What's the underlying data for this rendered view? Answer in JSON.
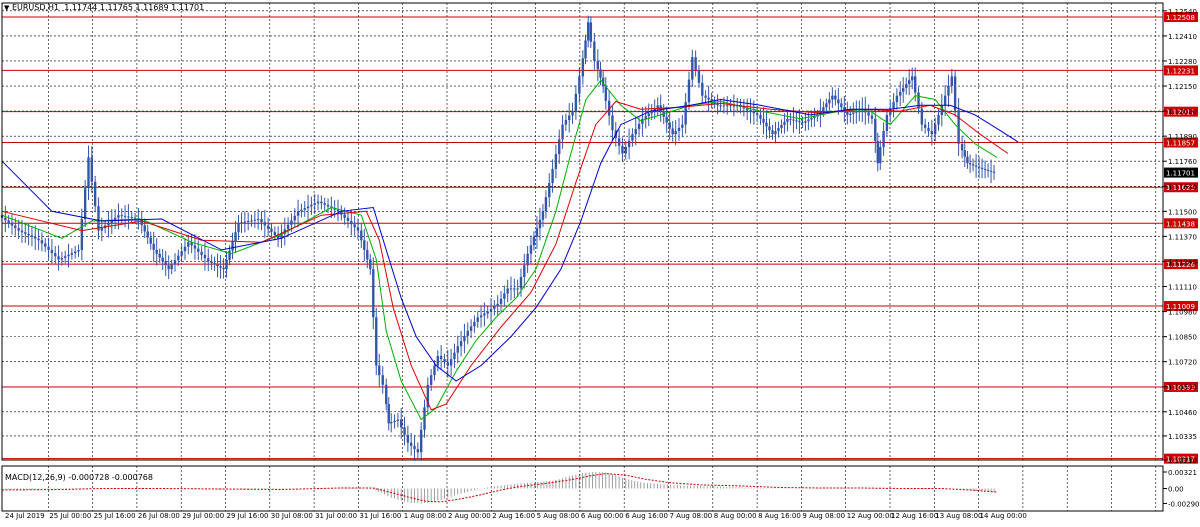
{
  "window": {
    "symbol_label": "EURUSD,H1",
    "ohlc_label": "1.11744 1.11765 1.11689 1.11701"
  },
  "chart_data": [
    {
      "type": "candlestick",
      "symbol": "EURUSD",
      "timeframe": "H1",
      "title": "EURUSD,H1  1.11744 1.11765 1.11689 1.11701",
      "ylim": [
        1.1021,
        1.1256
      ],
      "y_tick_labels": [
        "1.12540",
        "1.12410",
        "1.12280",
        "1.12150",
        "1.12020",
        "1.11890",
        "1.11760",
        "1.11630",
        "1.11500",
        "1.11370",
        "1.11240",
        "1.11110",
        "1.10980",
        "1.10850",
        "1.10720",
        "1.10590",
        "1.10460",
        "1.10335",
        "1.10210"
      ],
      "y_ticks": [
        1.1254,
        1.1241,
        1.1228,
        1.1215,
        1.1202,
        1.1189,
        1.1176,
        1.1163,
        1.115,
        1.1137,
        1.1124,
        1.1111,
        1.1098,
        1.1085,
        1.1072,
        1.1059,
        1.1046,
        1.10335,
        1.1021
      ],
      "x_tick_labels": [
        "24 Jul 2019",
        "25 Jul 00:00",
        "25 Jul 16:00",
        "26 Jul 08:00",
        "29 Jul 00:00",
        "29 Jul 16:00",
        "30 Jul 08:00",
        "31 Jul 00:00",
        "31 Jul 16:00",
        "1 Aug 08:00",
        "2 Aug 00:00",
        "2 Aug 16:00",
        "5 Aug 08:00",
        "6 Aug 00:00",
        "6 Aug 16:00",
        "7 Aug 08:00",
        "8 Aug 00:00",
        "8 Aug 16:00",
        "9 Aug 08:00",
        "12 Aug 00:00",
        "12 Aug 16:00",
        "13 Aug 08:00",
        "14 Aug 00:00"
      ],
      "last_price": "1.11701",
      "price_series": [
        [
          0,
          1.1148
        ],
        [
          20,
          1.114
        ],
        [
          40,
          1.1135
        ],
        [
          60,
          1.1125
        ],
        [
          80,
          1.113
        ],
        [
          90,
          1.1178
        ],
        [
          100,
          1.114
        ],
        [
          120,
          1.1148
        ],
        [
          140,
          1.1146
        ],
        [
          155,
          1.113
        ],
        [
          170,
          1.112
        ],
        [
          190,
          1.1134
        ],
        [
          210,
          1.1124
        ],
        [
          225,
          1.112
        ],
        [
          240,
          1.1144
        ],
        [
          260,
          1.1146
        ],
        [
          280,
          1.1136
        ],
        [
          300,
          1.115
        ],
        [
          320,
          1.1155
        ],
        [
          340,
          1.115
        ],
        [
          360,
          1.114
        ],
        [
          372,
          1.112
        ],
        [
          378,
          1.107
        ],
        [
          385,
          1.106
        ],
        [
          390,
          1.104
        ],
        [
          400,
          1.1042
        ],
        [
          410,
          1.103
        ],
        [
          420,
          1.1025
        ],
        [
          430,
          1.106
        ],
        [
          440,
          1.1075
        ],
        [
          450,
          1.107
        ],
        [
          460,
          1.108
        ],
        [
          470,
          1.1088
        ],
        [
          480,
          1.1095
        ],
        [
          490,
          1.1098
        ],
        [
          500,
          1.1102
        ],
        [
          510,
          1.111
        ],
        [
          520,
          1.111
        ],
        [
          530,
          1.1128
        ],
        [
          545,
          1.115
        ],
        [
          555,
          1.1172
        ],
        [
          565,
          1.1195
        ],
        [
          575,
          1.1202
        ],
        [
          582,
          1.122
        ],
        [
          590,
          1.1248
        ],
        [
          597,
          1.1228
        ],
        [
          605,
          1.1215
        ],
        [
          615,
          1.1192
        ],
        [
          625,
          1.118
        ],
        [
          635,
          1.119
        ],
        [
          645,
          1.1198
        ],
        [
          660,
          1.1205
        ],
        [
          675,
          1.119
        ],
        [
          685,
          1.1195
        ],
        [
          695,
          1.123
        ],
        [
          705,
          1.121
        ],
        [
          720,
          1.1205
        ],
        [
          740,
          1.1205
        ],
        [
          760,
          1.12
        ],
        [
          775,
          1.119
        ],
        [
          790,
          1.1198
        ],
        [
          805,
          1.1196
        ],
        [
          820,
          1.12
        ],
        [
          835,
          1.121
        ],
        [
          850,
          1.12
        ],
        [
          865,
          1.1203
        ],
        [
          875,
          1.1198
        ],
        [
          880,
          1.1175
        ],
        [
          890,
          1.12
        ],
        [
          900,
          1.121
        ],
        [
          915,
          1.122
        ],
        [
          925,
          1.1195
        ],
        [
          935,
          1.119
        ],
        [
          945,
          1.1205
        ],
        [
          955,
          1.122
        ],
        [
          962,
          1.1185
        ],
        [
          970,
          1.1175
        ],
        [
          985,
          1.1172
        ],
        [
          997,
          1.117
        ]
      ],
      "moving_averages": [
        {
          "color": "#00b000",
          "points": [
            [
              0,
              1.1148
            ],
            [
              60,
              1.1136
            ],
            [
              90,
              1.1145
            ],
            [
              140,
              1.1146
            ],
            [
              190,
              1.1134
            ],
            [
              230,
              1.1128
            ],
            [
              280,
              1.1138
            ],
            [
              330,
              1.1152
            ],
            [
              360,
              1.1148
            ],
            [
              375,
              1.1125
            ],
            [
              385,
              1.1088
            ],
            [
              400,
              1.1062
            ],
            [
              420,
              1.1042
            ],
            [
              435,
              1.1048
            ],
            [
              455,
              1.1067
            ],
            [
              475,
              1.1083
            ],
            [
              495,
              1.1095
            ],
            [
              515,
              1.1105
            ],
            [
              535,
              1.112
            ],
            [
              555,
              1.115
            ],
            [
              570,
              1.118
            ],
            [
              585,
              1.1208
            ],
            [
              600,
              1.1218
            ],
            [
              620,
              1.1205
            ],
            [
              640,
              1.1197
            ],
            [
              660,
              1.12
            ],
            [
              690,
              1.1205
            ],
            [
              720,
              1.1207
            ],
            [
              760,
              1.1202
            ],
            [
              800,
              1.1198
            ],
            [
              840,
              1.1202
            ],
            [
              870,
              1.1202
            ],
            [
              890,
              1.1195
            ],
            [
              915,
              1.121
            ],
            [
              935,
              1.1208
            ],
            [
              955,
              1.1195
            ],
            [
              975,
              1.1185
            ],
            [
              997,
              1.1178
            ]
          ]
        },
        {
          "color": "#e00000",
          "points": [
            [
              0,
              1.115
            ],
            [
              80,
              1.114
            ],
            [
              140,
              1.1145
            ],
            [
              200,
              1.1135
            ],
            [
              260,
              1.1134
            ],
            [
              320,
              1.1148
            ],
            [
              365,
              1.115
            ],
            [
              378,
              1.1135
            ],
            [
              392,
              1.11
            ],
            [
              410,
              1.107
            ],
            [
              430,
              1.1047
            ],
            [
              445,
              1.105
            ],
            [
              470,
              1.107
            ],
            [
              500,
              1.109
            ],
            [
              530,
              1.1108
            ],
            [
              555,
              1.1133
            ],
            [
              575,
              1.1165
            ],
            [
              595,
              1.1195
            ],
            [
              615,
              1.1207
            ],
            [
              640,
              1.1203
            ],
            [
              680,
              1.1204
            ],
            [
              720,
              1.1206
            ],
            [
              770,
              1.1203
            ],
            [
              820,
              1.1201
            ],
            [
              860,
              1.1203
            ],
            [
              900,
              1.1202
            ],
            [
              930,
              1.1205
            ],
            [
              955,
              1.12
            ],
            [
              980,
              1.119
            ],
            [
              1008,
              1.118
            ]
          ]
        },
        {
          "color": "#0000cc",
          "points": [
            [
              0,
              1.1176
            ],
            [
              50,
              1.115
            ],
            [
              100,
              1.1145
            ],
            [
              160,
              1.1146
            ],
            [
              220,
              1.113
            ],
            [
              280,
              1.1136
            ],
            [
              340,
              1.115
            ],
            [
              372,
              1.1152
            ],
            [
              385,
              1.113
            ],
            [
              400,
              1.1105
            ],
            [
              415,
              1.1085
            ],
            [
              435,
              1.107
            ],
            [
              455,
              1.1062
            ],
            [
              480,
              1.107
            ],
            [
              510,
              1.1085
            ],
            [
              535,
              1.11
            ],
            [
              560,
              1.112
            ],
            [
              580,
              1.1145
            ],
            [
              600,
              1.1175
            ],
            [
              620,
              1.1195
            ],
            [
              650,
              1.1202
            ],
            [
              690,
              1.1205
            ],
            [
              720,
              1.1208
            ],
            [
              760,
              1.1205
            ],
            [
              810,
              1.12
            ],
            [
              850,
              1.1203
            ],
            [
              890,
              1.1203
            ],
            [
              920,
              1.1205
            ],
            [
              950,
              1.1205
            ],
            [
              975,
              1.12
            ],
            [
              1000,
              1.1192
            ],
            [
              1018,
              1.1186
            ]
          ]
        }
      ],
      "horizontal_levels": [
        {
          "value": 1.12508,
          "label": "1.12508"
        },
        {
          "value": 1.12231,
          "label": "1.12231"
        },
        {
          "value": 1.12017,
          "label": "1.12017"
        },
        {
          "value": 1.11857,
          "label": "1.11857"
        },
        {
          "value": 1.11625,
          "label": "1.11625"
        },
        {
          "value": 1.11438,
          "label": "1.11438"
        },
        {
          "value": 1.11226,
          "label": "1.11226"
        },
        {
          "value": 1.11009,
          "label": "1.11009"
        },
        {
          "value": 1.10589,
          "label": "1.10589"
        },
        {
          "value": 1.10217,
          "label": "1.10217"
        }
      ],
      "colors": {
        "candles": "#3355aa",
        "levels": "#cc0000",
        "grid": "#000000"
      }
    },
    {
      "type": "histogram",
      "title": "MACD(12,26,9) -0.000728 -0.000768",
      "ylim": [
        -0.0036,
        0.0036
      ],
      "y_tick_labels": [
        "0.00321",
        "0.00",
        "-0.002908"
      ],
      "y_ticks": [
        0.00321,
        0.0,
        -0.002908
      ],
      "histogram": [
        [
          0,
          -0.0003
        ],
        [
          40,
          -0.0002
        ],
        [
          80,
          -0.0001
        ],
        [
          100,
          0.0001
        ],
        [
          140,
          0.0001
        ],
        [
          180,
          -0.0001
        ],
        [
          220,
          -0.0002
        ],
        [
          260,
          -0.0002
        ],
        [
          300,
          0.0
        ],
        [
          340,
          0.0002
        ],
        [
          360,
          0.0001
        ],
        [
          372,
          -0.0002
        ],
        [
          380,
          -0.0008
        ],
        [
          390,
          -0.0018
        ],
        [
          400,
          -0.0024
        ],
        [
          410,
          -0.0028
        ],
        [
          420,
          -0.0029
        ],
        [
          430,
          -0.0027
        ],
        [
          440,
          -0.0022
        ],
        [
          450,
          -0.0016
        ],
        [
          460,
          -0.001
        ],
        [
          470,
          -0.0005
        ],
        [
          480,
          0.0
        ],
        [
          500,
          0.0006
        ],
        [
          520,
          0.001
        ],
        [
          540,
          0.0013
        ],
        [
          555,
          0.0016
        ],
        [
          565,
          0.0022
        ],
        [
          575,
          0.0027
        ],
        [
          585,
          0.0031
        ],
        [
          595,
          0.0032
        ],
        [
          605,
          0.0031
        ],
        [
          615,
          0.0026
        ],
        [
          625,
          0.0019
        ],
        [
          640,
          0.0012
        ],
        [
          660,
          0.0008
        ],
        [
          690,
          0.0005
        ],
        [
          720,
          0.0004
        ],
        [
          760,
          0.0001
        ],
        [
          800,
          0.0
        ],
        [
          840,
          0.0001
        ],
        [
          880,
          -0.0001
        ],
        [
          920,
          0.0001
        ],
        [
          950,
          0.0
        ],
        [
          970,
          -0.0004
        ],
        [
          985,
          -0.0006
        ],
        [
          997,
          -0.0007
        ]
      ],
      "signal": [
        [
          0,
          -0.0003
        ],
        [
          60,
          -0.0002
        ],
        [
          100,
          0.0
        ],
        [
          160,
          0.0
        ],
        [
          220,
          -0.0001
        ],
        [
          280,
          -0.0002
        ],
        [
          340,
          0.0001
        ],
        [
          372,
          0.0001
        ],
        [
          390,
          -0.0008
        ],
        [
          410,
          -0.0018
        ],
        [
          425,
          -0.0025
        ],
        [
          440,
          -0.0026
        ],
        [
          460,
          -0.002
        ],
        [
          480,
          -0.0012
        ],
        [
          500,
          -0.0003
        ],
        [
          520,
          0.0004
        ],
        [
          545,
          0.001
        ],
        [
          570,
          0.0017
        ],
        [
          590,
          0.0025
        ],
        [
          605,
          0.0029
        ],
        [
          625,
          0.0026
        ],
        [
          645,
          0.0018
        ],
        [
          670,
          0.0011
        ],
        [
          700,
          0.0007
        ],
        [
          740,
          0.0005
        ],
        [
          780,
          0.0002
        ],
        [
          820,
          0.0001
        ],
        [
          860,
          0.0001
        ],
        [
          900,
          0.0
        ],
        [
          940,
          0.0
        ],
        [
          970,
          -0.0003
        ],
        [
          997,
          -0.0007
        ]
      ],
      "colors": {
        "histogram": "#888888",
        "signal": "#cc0000"
      }
    }
  ]
}
